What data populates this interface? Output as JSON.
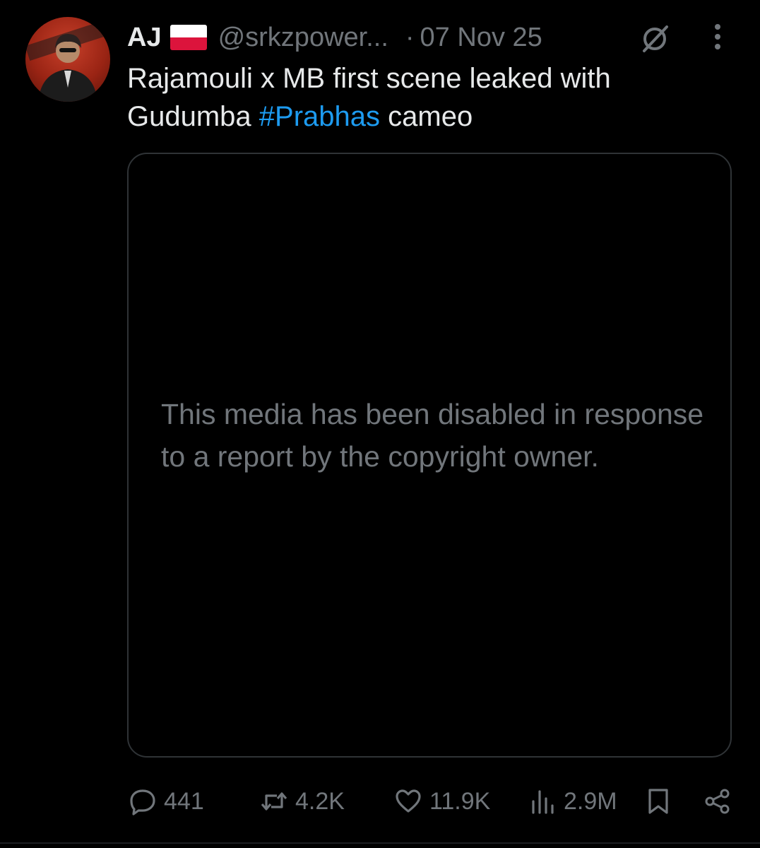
{
  "tweet": {
    "display_name": "AJ",
    "flag_icon": "poland-flag-icon",
    "handle": "@srkzpower...",
    "separator": "·",
    "date": "07 Nov 25",
    "text_before": "Rajamouli x MB first scene leaked with Gudumba ",
    "hashtag": "#Prabhas",
    "text_after": " cameo",
    "media_notice": "This media has been disabled in response to a report by the copyright owner."
  },
  "actions": {
    "replies": "441",
    "reposts": "4.2K",
    "likes": "11.9K",
    "views": "2.9M"
  },
  "icons": {
    "grok": "grok-icon",
    "more": "more-options-icon",
    "reply": "reply-icon",
    "repost": "repost-icon",
    "like": "heart-icon",
    "views": "views-icon",
    "bookmark": "bookmark-icon",
    "share": "share-icon"
  },
  "colors": {
    "background": "#000000",
    "text": "#e7e9ea",
    "muted": "#71767b",
    "link": "#1d9bf0",
    "border": "#2f3336"
  }
}
